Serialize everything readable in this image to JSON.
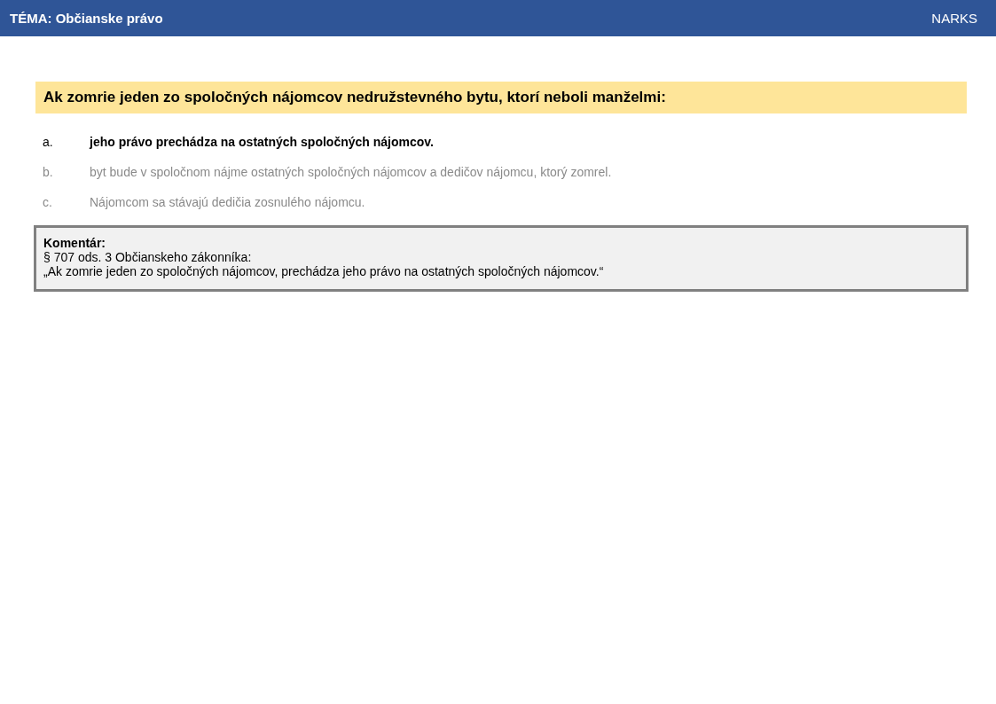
{
  "header": {
    "topic": "TÉMA: Občianske právo",
    "brand": "NARKS"
  },
  "question": "Ak zomrie jeden zo spoločných nájomcov nedružstevného bytu, ktorí neboli manželmi:",
  "answers": [
    {
      "letter": "a.",
      "text": "jeho právo prechádza na ostatných spoločných nájomcov.",
      "correct": true
    },
    {
      "letter": "b.",
      "text": "byt bude v spoločnom nájme ostatných spoločných nájomcov a dedičov nájomcu, ktorý zomrel.",
      "correct": false
    },
    {
      "letter": "c.",
      "text": "Nájomcom sa stávajú dedičia zosnulého nájomcu.",
      "correct": false
    }
  ],
  "comment": {
    "title": "Komentár:",
    "lines": [
      "§ 707 ods. 3 Občianskeho zákonníka:",
      "„Ak zomrie jeden zo spoločných nájomcov, prechádza jeho právo na ostatných spoločných nájomcov.“"
    ]
  }
}
